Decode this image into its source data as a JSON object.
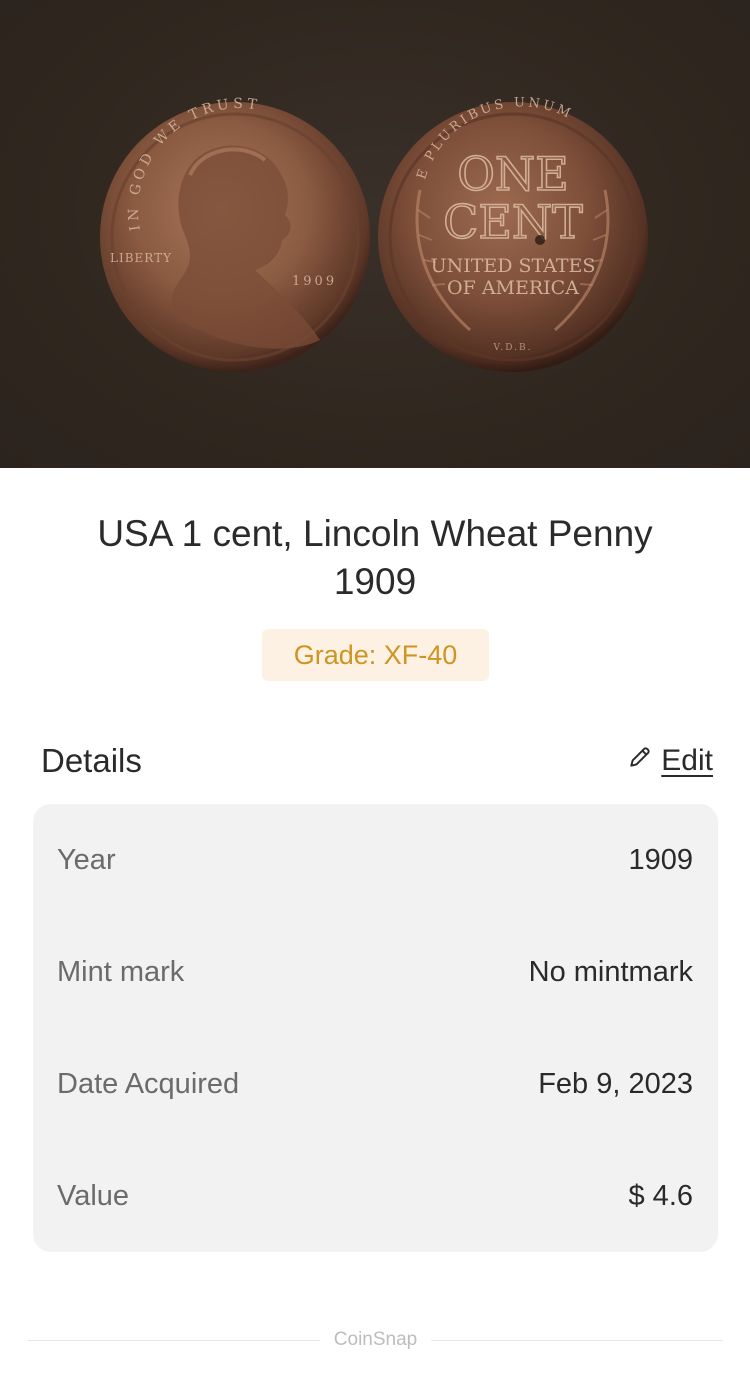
{
  "hero": {
    "obverse": {
      "motto": "IN GOD WE TRUST",
      "left_text": "LIBERTY",
      "date": "1909"
    },
    "reverse": {
      "top_text": "E PLURIBUS UNUM",
      "line1": "ONE",
      "line2": "CENT",
      "line3": "UNITED STATES",
      "line4": "OF AMERICA",
      "bottom_text": "V.D.B."
    }
  },
  "coin": {
    "title": "USA 1 cent, Lincoln Wheat Penny 1909",
    "grade": "Grade: XF-40"
  },
  "details": {
    "heading": "Details",
    "edit_label": "Edit",
    "edit_icon": "pencil-icon",
    "rows": [
      {
        "key": "Year",
        "value": "1909"
      },
      {
        "key": "Mint mark",
        "value": "No mintmark"
      },
      {
        "key": "Date Acquired",
        "value": "Feb 9, 2023"
      },
      {
        "key": "Value",
        "value": "$ 4.6"
      }
    ]
  },
  "footer": {
    "brand": "CoinSnap"
  },
  "colors": {
    "hero_bg": "#30271f",
    "grade_text": "#cf9422",
    "grade_bg": "#fdf1e3",
    "card_bg": "#f2f2f2"
  }
}
